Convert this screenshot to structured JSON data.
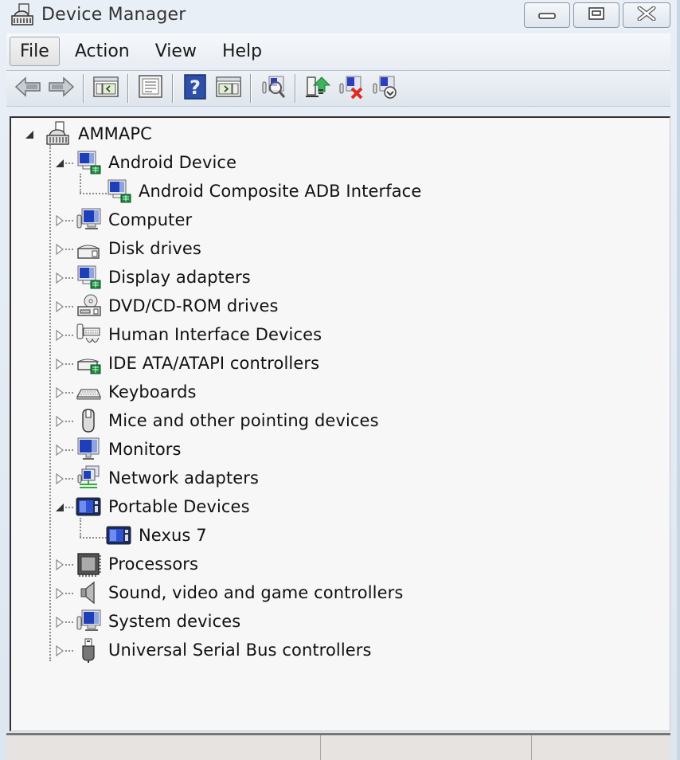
{
  "window": {
    "title": "Device Manager",
    "icon": "device-manager-icon",
    "controls": [
      {
        "name": "minimize",
        "icon": "minimize-icon"
      },
      {
        "name": "maximize",
        "icon": "maximize-icon"
      },
      {
        "name": "close",
        "icon": "close-icon"
      }
    ]
  },
  "menu": {
    "items": [
      {
        "label": "File",
        "active": true
      },
      {
        "label": "Action",
        "active": false
      },
      {
        "label": "View",
        "active": false
      },
      {
        "label": "Help",
        "active": false
      }
    ]
  },
  "toolbar": {
    "buttons": [
      {
        "name": "back",
        "icon": "back-arrow-icon"
      },
      {
        "name": "forward",
        "icon": "forward-arrow-icon"
      },
      {
        "name": "show-hide-console-tree",
        "icon": "console-tree-icon"
      },
      {
        "name": "properties",
        "icon": "properties-icon"
      },
      {
        "name": "help",
        "icon": "help-icon"
      },
      {
        "name": "show-hide-action-pane",
        "icon": "action-pane-icon"
      },
      {
        "name": "scan-hardware-changes",
        "icon": "scan-hardware-icon"
      },
      {
        "name": "update-driver",
        "icon": "update-driver-icon"
      },
      {
        "name": "uninstall",
        "icon": "uninstall-icon"
      },
      {
        "name": "disable",
        "icon": "disable-device-icon"
      }
    ]
  },
  "tree": {
    "root": {
      "label": "AMMAPC",
      "icon": "computer-root-icon",
      "expanded": true
    },
    "categories": [
      {
        "label": "Android Device",
        "icon": "android-device-icon",
        "expanded": true,
        "children": [
          {
            "label": "Android Composite ADB Interface",
            "icon": "android-device-icon"
          }
        ]
      },
      {
        "label": "Computer",
        "icon": "computer-icon",
        "expanded": false
      },
      {
        "label": "Disk drives",
        "icon": "disk-drive-icon",
        "expanded": false
      },
      {
        "label": "Display adapters",
        "icon": "display-adapter-icon",
        "expanded": false
      },
      {
        "label": "DVD/CD-ROM drives",
        "icon": "dvd-drive-icon",
        "expanded": false
      },
      {
        "label": "Human Interface Devices",
        "icon": "hid-icon",
        "expanded": false
      },
      {
        "label": "IDE ATA/ATAPI controllers",
        "icon": "ide-controller-icon",
        "expanded": false
      },
      {
        "label": "Keyboards",
        "icon": "keyboard-icon",
        "expanded": false
      },
      {
        "label": "Mice and other pointing devices",
        "icon": "mouse-icon",
        "expanded": false
      },
      {
        "label": "Monitors",
        "icon": "monitor-icon",
        "expanded": false
      },
      {
        "label": "Network adapters",
        "icon": "network-adapter-icon",
        "expanded": false
      },
      {
        "label": "Portable Devices",
        "icon": "portable-device-icon",
        "expanded": true,
        "children": [
          {
            "label": "Nexus 7",
            "icon": "portable-device-icon"
          }
        ]
      },
      {
        "label": "Processors",
        "icon": "processor-icon",
        "expanded": false
      },
      {
        "label": "Sound, video and game controllers",
        "icon": "speaker-icon",
        "expanded": false
      },
      {
        "label": "System devices",
        "icon": "system-device-icon",
        "expanded": false
      },
      {
        "label": "Universal Serial Bus controllers",
        "icon": "usb-icon",
        "expanded": false
      }
    ]
  },
  "statusbar": {
    "cells": [
      "",
      "",
      ""
    ]
  },
  "colors": {
    "frame": "#dde6f0",
    "tree_background": "#f7f7f7",
    "statusbar": "#e6e3e0",
    "icon_blue": "#1f3fb8"
  }
}
